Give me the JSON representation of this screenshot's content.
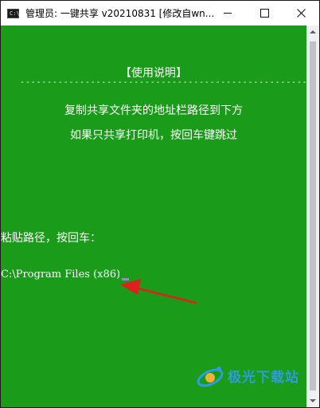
{
  "window": {
    "title": "管理员:  一键共享 v20210831 [修改自wn..."
  },
  "console": {
    "heading": "【使用说明】",
    "separator": "--------------------------------------------------------",
    "instruction_1": "复制共享文件夹的地址栏路径到下方",
    "instruction_2": "如果只共享打印机，按回车键跳过",
    "paste_prompt": "粘贴路径，按回车：",
    "input_value": "C:\\Program Files (x86)"
  },
  "watermark": {
    "text": "极光下载站"
  },
  "colors": {
    "console_bg": "#1a9b1a",
    "console_text": "#ffffff",
    "cursor": "#b074ff",
    "arrow": "#e0201c",
    "watermark": "#2f9be0"
  },
  "icons": {
    "app": "cmd-icon",
    "minimize": "minimize-icon",
    "maximize": "maximize-icon",
    "close": "close-icon",
    "annotation": "red-arrow-annotation",
    "watermark_logo": "watermark-logo-icon"
  }
}
